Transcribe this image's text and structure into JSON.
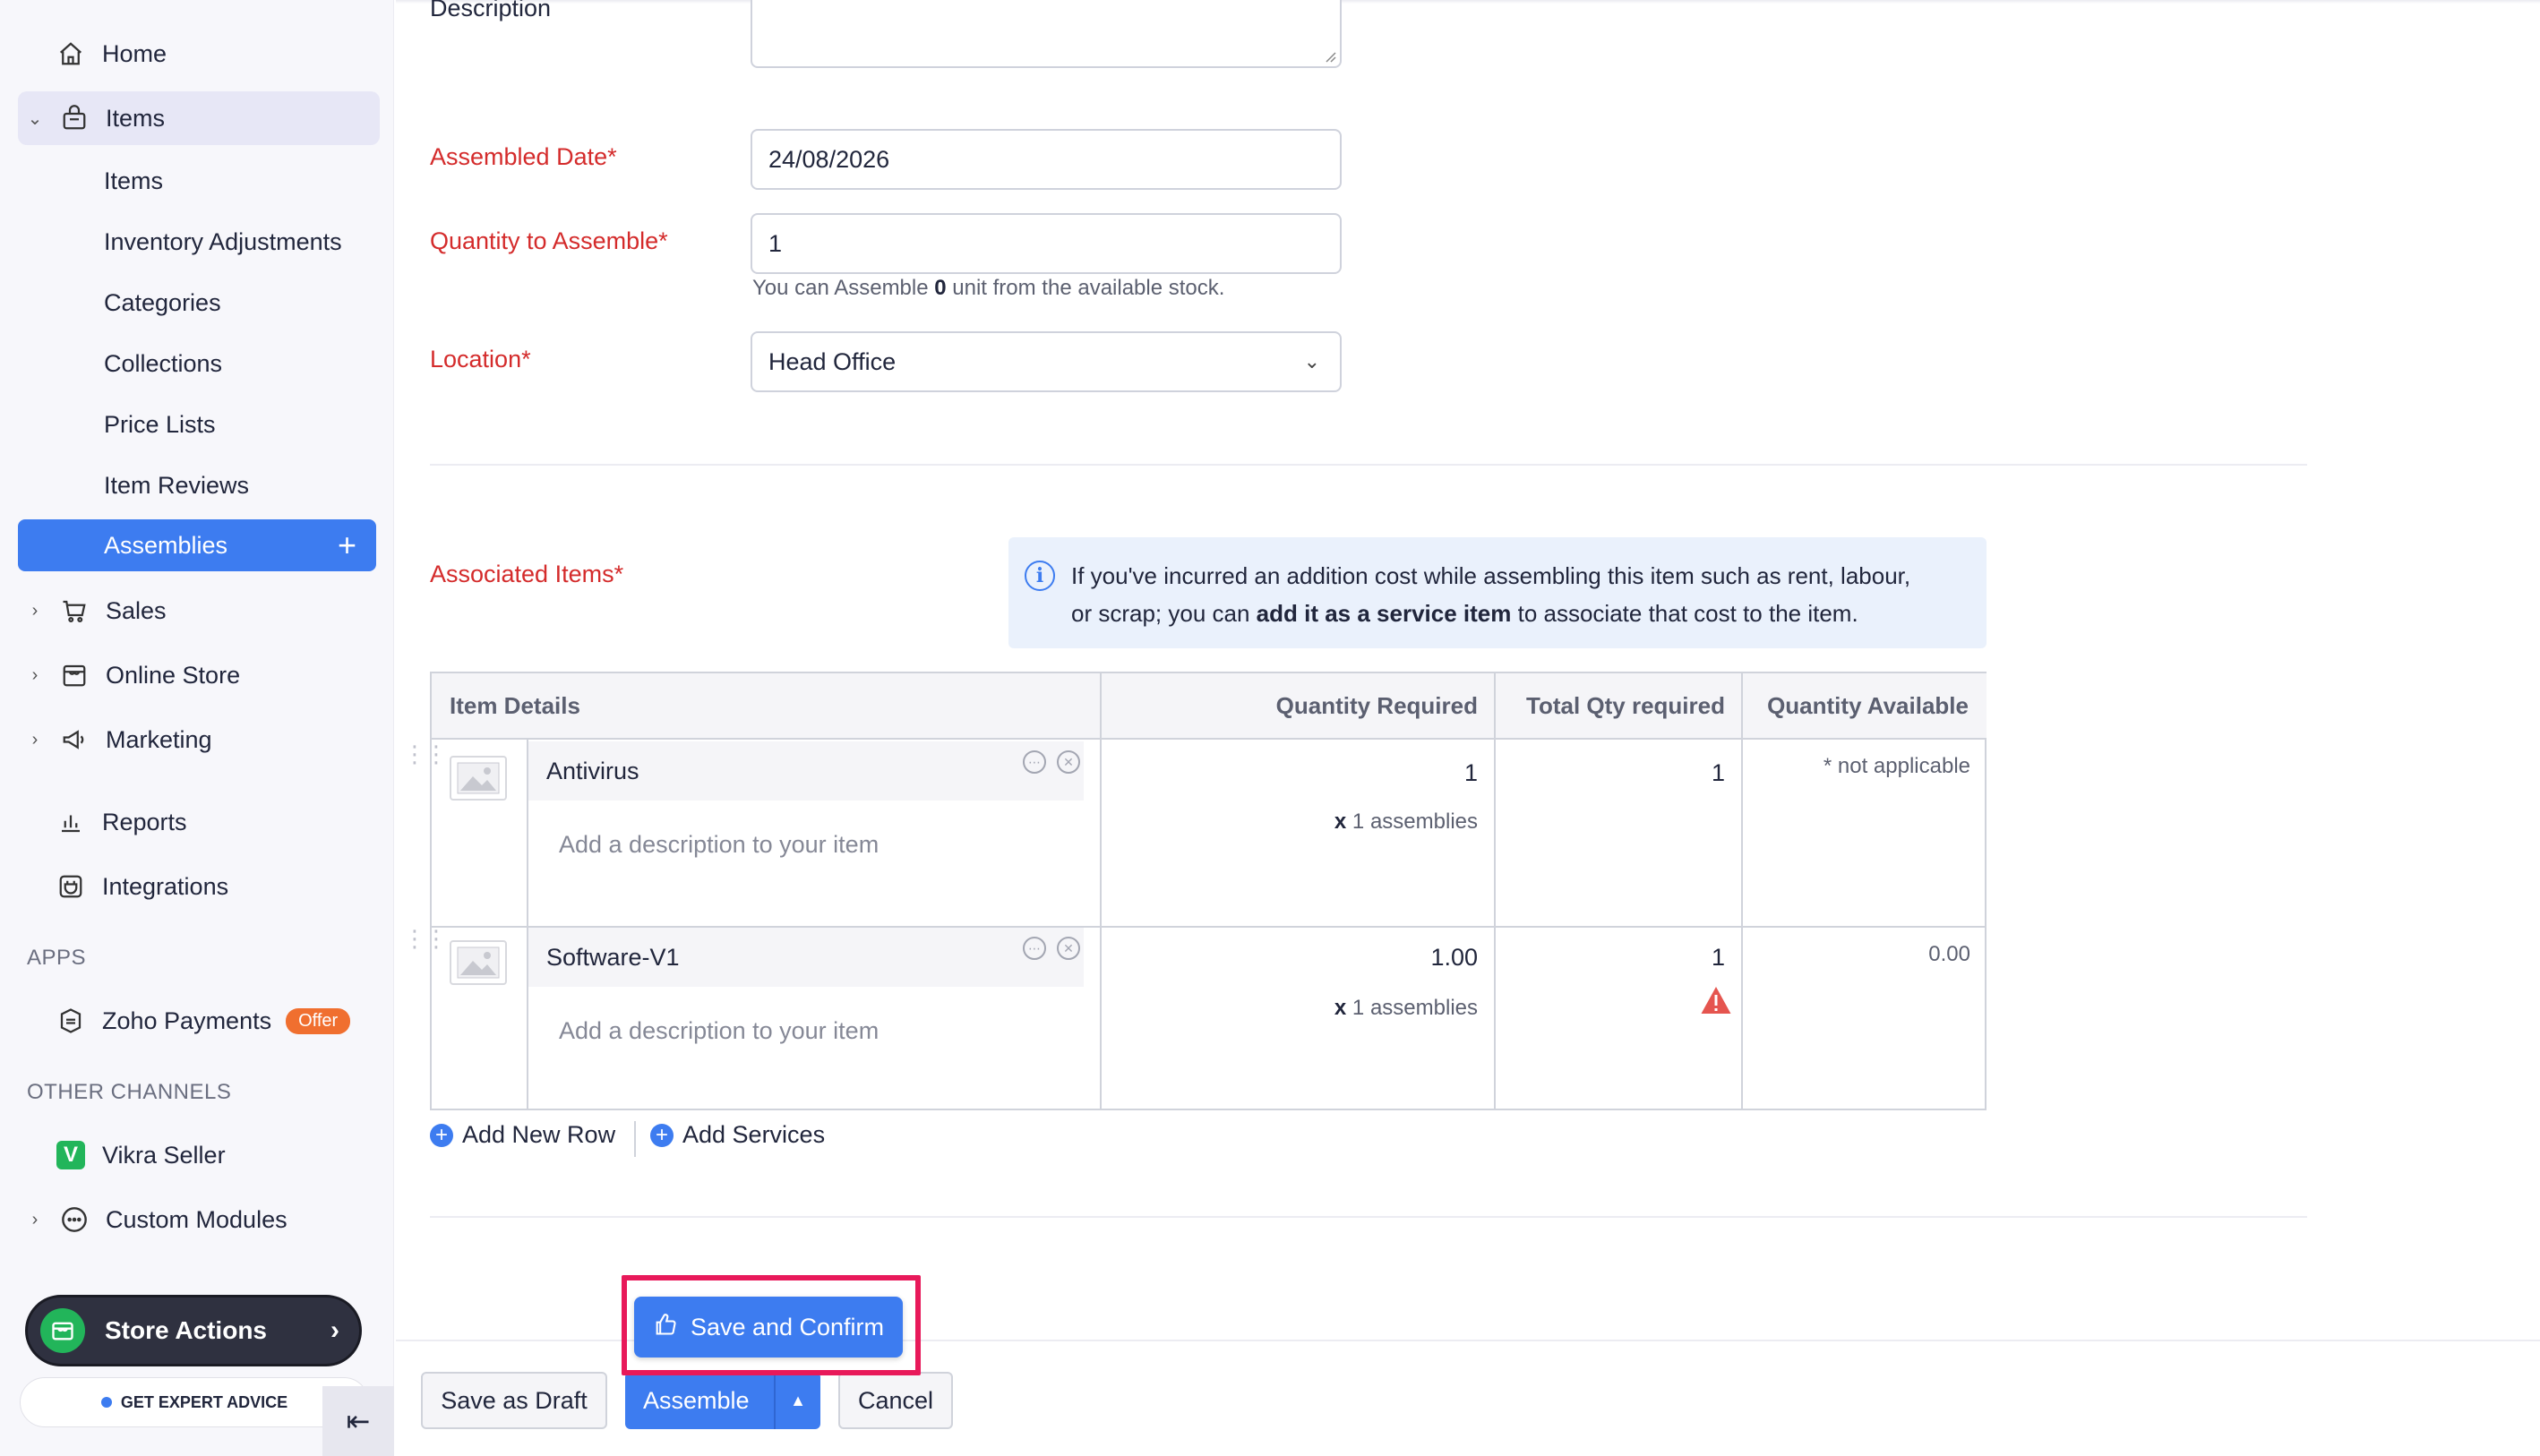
{
  "sidebar": {
    "home": "Home",
    "items_group": "Items",
    "sub_items": [
      "Items",
      "Inventory Adjustments",
      "Categories",
      "Collections",
      "Price Lists",
      "Item Reviews"
    ],
    "assemblies": "Assemblies",
    "sales": "Sales",
    "online_store": "Online Store",
    "marketing": "Marketing",
    "reports": "Reports",
    "integrations": "Integrations",
    "apps_heading": "APPS",
    "zoho_payments": "Zoho Payments",
    "offer_badge": "Offer",
    "other_channels_heading": "OTHER CHANNELS",
    "vikra_seller": "Vikra Seller",
    "custom_modules": "Custom Modules",
    "store_actions": "Store Actions",
    "expert_advice": "GET EXPERT ADVICE"
  },
  "form": {
    "description_label": "Description",
    "assembled_date_label": "Assembled Date*",
    "assembled_date_value": "24/08/2026",
    "quantity_label": "Quantity to Assemble*",
    "quantity_value": "1",
    "hint_prefix": "You can Assemble ",
    "hint_count": "0",
    "hint_suffix": " unit from the available stock.",
    "location_label": "Location*",
    "location_value": "Head Office",
    "associated_items_label": "Associated Items*"
  },
  "info": {
    "line1": "If you've incurred an addition cost while assembling this item such as rent, labour,",
    "line2_prefix": "or scrap; you can ",
    "line2_bold": "add it as a service item",
    "line2_suffix": " to associate that cost to the item."
  },
  "table": {
    "headers": [
      "Item Details",
      "Quantity Required",
      "Total Qty required",
      "Quantity Available"
    ],
    "rows": [
      {
        "name": "Antivirus",
        "desc_placeholder": "Add a description to your item",
        "qty_required": "1",
        "multiplier_x": "x",
        "multiplier_text": " 1 assemblies",
        "total_qty": "1",
        "available": "* not applicable"
      },
      {
        "name": "Software-V1",
        "desc_placeholder": "Add a description to your item",
        "qty_required": "1.00",
        "multiplier_x": "x",
        "multiplier_text": " 1 assemblies",
        "total_qty": "1",
        "available": "0.00"
      }
    ]
  },
  "links": {
    "add_new_row": "Add New Row",
    "add_services": "Add Services"
  },
  "actions": {
    "save_and_confirm": "Save and Confirm",
    "save_as_draft": "Save as Draft",
    "assemble": "Assemble",
    "cancel": "Cancel"
  },
  "colors": {
    "primary": "#3d7cf0",
    "required_label": "#d42b2b",
    "highlight": "#e8195a",
    "warning": "#e5554f"
  }
}
